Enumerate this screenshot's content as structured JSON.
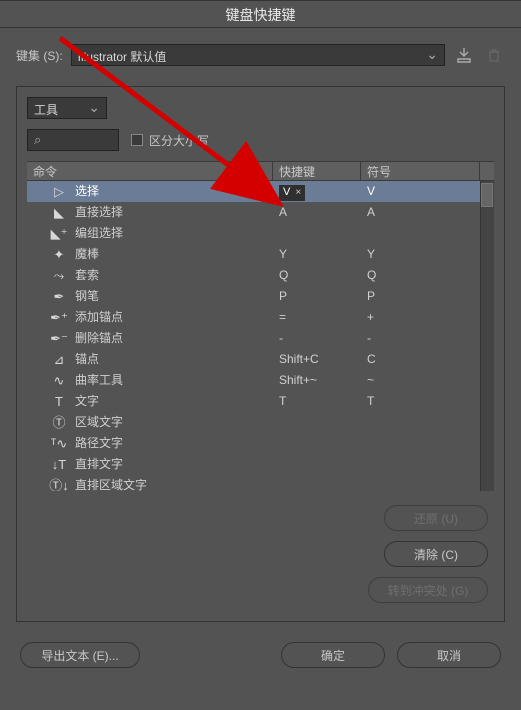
{
  "title": "键盘快捷键",
  "preset": {
    "label": "键集 (S):",
    "value": "Illustrator 默认值"
  },
  "tool_select": "工具",
  "case_label": "区分大小写",
  "headers": {
    "cmd": "命令",
    "key": "快捷键",
    "sym": "符号"
  },
  "rows": [
    {
      "icon": "▷",
      "name": "选择",
      "key": "V",
      "sym": "V",
      "selected": true,
      "editing": true
    },
    {
      "icon": "◣",
      "name": "直接选择",
      "key": "A",
      "sym": "A"
    },
    {
      "icon": "◣⁺",
      "name": "编组选择",
      "key": "",
      "sym": ""
    },
    {
      "icon": "✦",
      "name": "魔棒",
      "key": "Y",
      "sym": "Y"
    },
    {
      "icon": "⤳",
      "name": "套索",
      "key": "Q",
      "sym": "Q"
    },
    {
      "icon": "✒",
      "name": "钢笔",
      "key": "P",
      "sym": "P"
    },
    {
      "icon": "✒⁺",
      "name": "添加锚点",
      "key": "=",
      "sym": "+"
    },
    {
      "icon": "✒⁻",
      "name": "删除锚点",
      "key": "-",
      "sym": "-"
    },
    {
      "icon": "⊿",
      "name": "锚点",
      "key": "Shift+C",
      "sym": "C"
    },
    {
      "icon": "∿",
      "name": "曲率工具",
      "key": "Shift+~",
      "sym": "~"
    },
    {
      "icon": "T",
      "name": "文字",
      "key": "T",
      "sym": "T"
    },
    {
      "icon": "Ⓣ",
      "name": "区域文字",
      "key": "",
      "sym": ""
    },
    {
      "icon": "ᵀ∿",
      "name": "路径文字",
      "key": "",
      "sym": ""
    },
    {
      "icon": "↓T",
      "name": "直排文字",
      "key": "",
      "sym": ""
    },
    {
      "icon": "Ⓣ↓",
      "name": "直排区域文字",
      "key": "",
      "sym": ""
    }
  ],
  "buttons": {
    "undo": "还原 (U)",
    "clear": "清除 (C)",
    "conflict": "转到冲突处 (G)",
    "export": "导出文本 (E)...",
    "ok": "确定",
    "cancel": "取消"
  }
}
